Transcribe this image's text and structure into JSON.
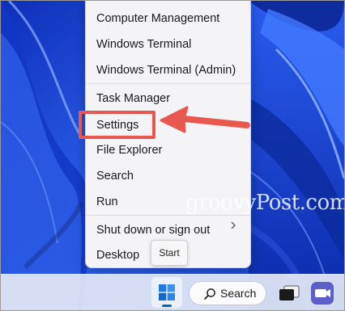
{
  "menu": {
    "items_group1": [
      "Computer Management",
      "Windows Terminal",
      "Windows Terminal (Admin)"
    ],
    "items_group2": [
      "Task Manager",
      "Settings",
      "File Explorer",
      "Search",
      "Run"
    ],
    "shutdown_label": "Shut down or sign out",
    "desktop_label": "Desktop"
  },
  "start_tooltip": "Start",
  "watermark": "groovyPost.com",
  "taskbar": {
    "search_label": "Search",
    "icons": [
      "windows-start-icon",
      "search-icon",
      "task-view-icon",
      "teams-chat-icon"
    ]
  },
  "colors": {
    "highlight": "#e8584f",
    "wallpaper_blue": "#1f4de0",
    "accent": "#0067c0"
  }
}
